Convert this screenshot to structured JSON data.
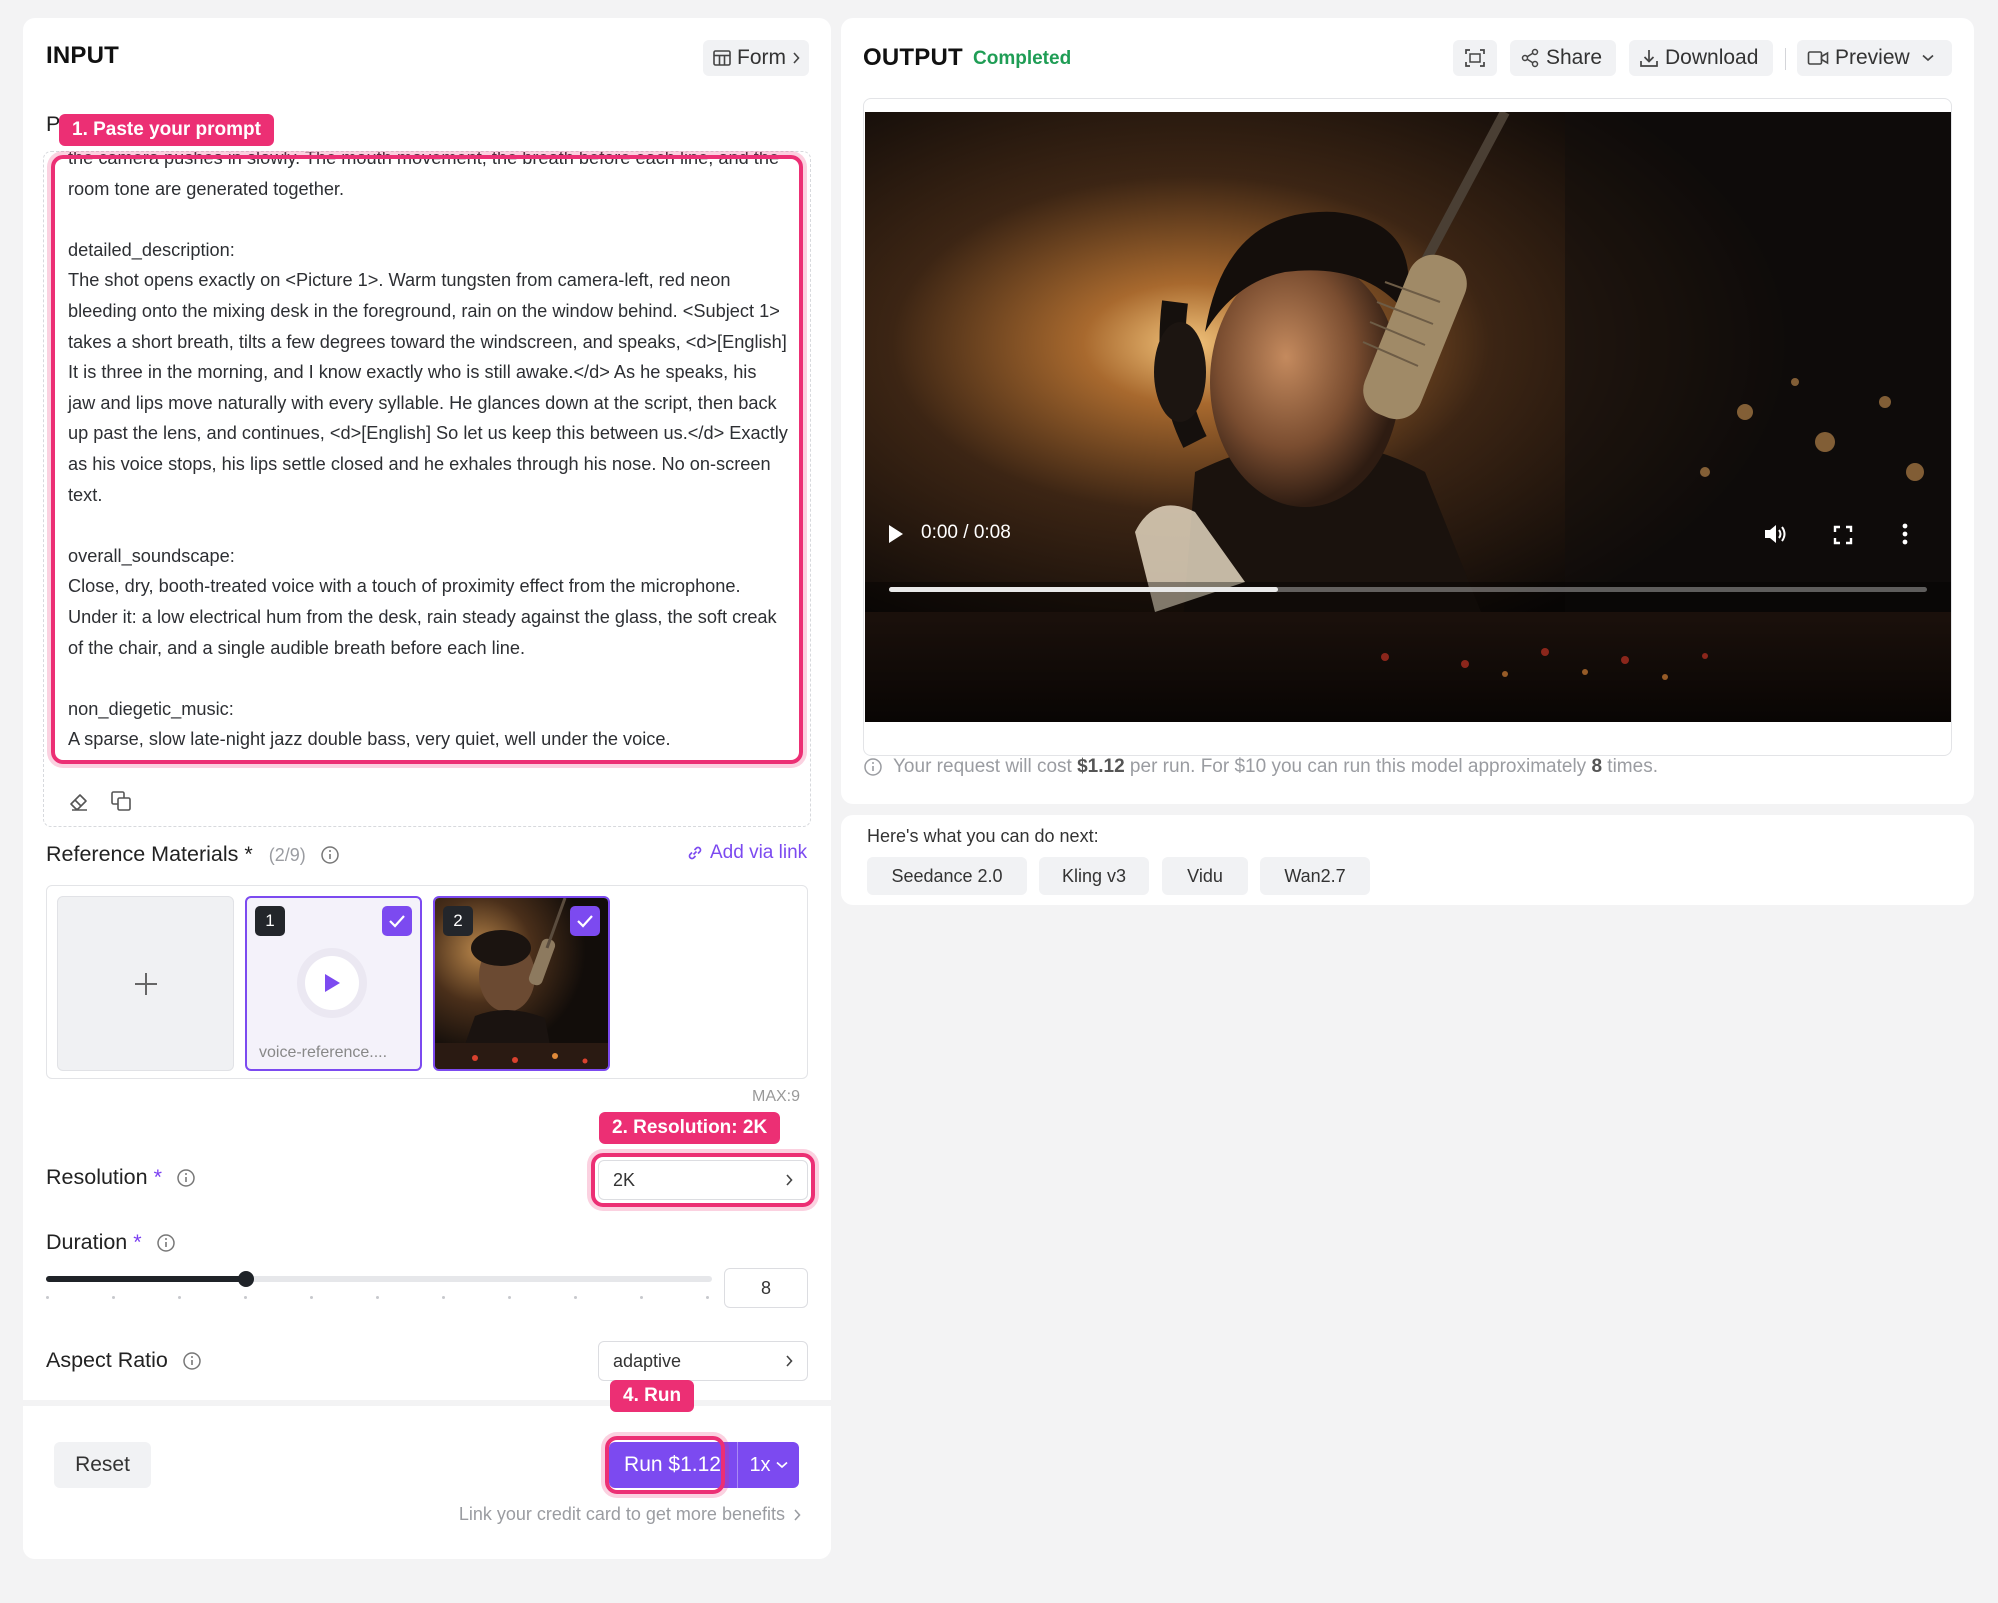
{
  "input": {
    "title": "INPUT",
    "form_label": "Form",
    "prompt_label_fragment": "P",
    "prompt_text": "the camera pushes in slowly. The mouth movement, the breath before each line, and the room tone are generated together.\n\ndetailed_description:\nThe shot opens exactly on <Picture 1>. Warm tungsten from camera-left, red neon bleeding onto the mixing desk in the foreground, rain on the window behind. <Subject 1> takes a short breath, tilts a few degrees toward the windscreen, and speaks, <d>[English] It is three in the morning, and I know exactly who is still awake.</d> As he speaks, his jaw and lips move naturally with every syllable. He glances down at the script, then back up past the lens, and continues, <d>[English] So let us keep this between us.</d> Exactly as his voice stops, his lips settle closed and he exhales through his nose. No on-screen text.\n\noverall_soundscape:\nClose, dry, booth-treated voice with a touch of proximity effect from the microphone. Under it: a low electrical hum from the desk, rain steady against the glass, the soft creak of the chair, and a single audible breath before each line.\n\nnon_diegetic_music:\nA sparse, slow late-night jazz double bass, very quiet, well under the voice.",
    "reference": {
      "label": "Reference Materials",
      "required_mark": "*",
      "count": "(2/9)",
      "add_link": "Add via link",
      "items": [
        {
          "number": "1",
          "caption": "voice-reference...."
        },
        {
          "number": "2",
          "caption": ""
        }
      ],
      "max_label": "MAX:9"
    },
    "resolution": {
      "label": "Resolution",
      "required_mark": "*",
      "value": "2K"
    },
    "duration": {
      "label": "Duration",
      "required_mark": "*",
      "value": "8",
      "fraction": 0.3
    },
    "aspect": {
      "label": "Aspect Ratio",
      "value": "adaptive"
    },
    "reset_label": "Reset",
    "run_label": "Run $1.12",
    "multiplier": "1x",
    "credit_note": "Link your credit card to get more benefits"
  },
  "annotations": {
    "a1": "1. Paste your prompt",
    "a2": "2. Resolution: 2K",
    "a4": "4. Run"
  },
  "output": {
    "title": "OUTPUT",
    "status": "Completed",
    "share_label": "Share",
    "download_label": "Download",
    "preview_label": "Preview",
    "video_time": "0:00 / 0:08",
    "progress": 0.375,
    "cost_prefix": "Your request will cost ",
    "cost_amount": "$1.12",
    "cost_middle": " per run. For $10 you can run this model approximately ",
    "cost_count": "8",
    "cost_suffix": " times."
  },
  "next": {
    "label": "Here's what you can do next:",
    "chips": [
      "Seedance 2.0",
      "Kling v3",
      "Vidu",
      "Wan2.7"
    ]
  },
  "colors": {
    "accent": "#7c4af0",
    "status_green": "#1f9d55",
    "annotation": "#ec2f74"
  }
}
